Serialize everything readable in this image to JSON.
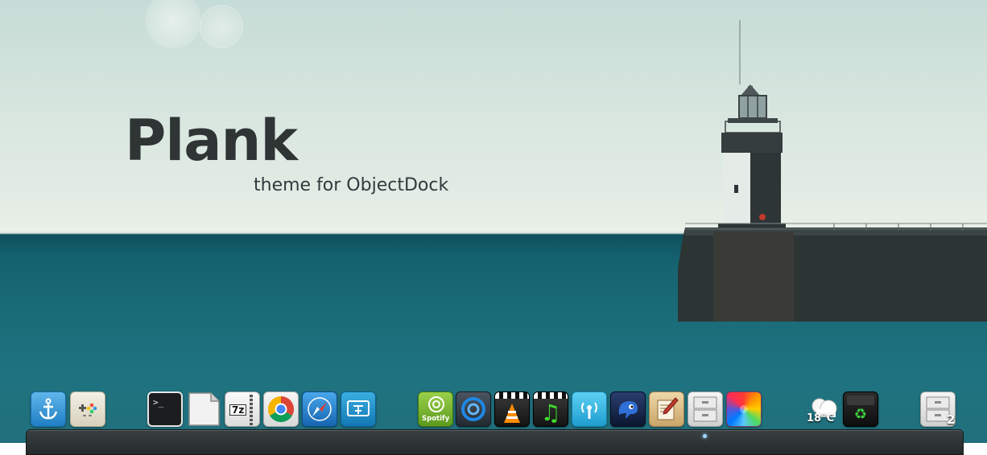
{
  "headline": {
    "title": "Plank",
    "subtitle": "theme for ObjectDock"
  },
  "dock": {
    "items": [
      {
        "name": "plank-anchor",
        "icon": "anchor-icon"
      },
      {
        "name": "game-controller",
        "icon": "gamepad-icon"
      },
      {
        "name": "terminal",
        "icon": "terminal-icon",
        "label": ">_"
      },
      {
        "name": "text-document",
        "icon": "document-icon"
      },
      {
        "name": "7zip-archive",
        "icon": "archive-icon",
        "label": "7z"
      },
      {
        "name": "chrome-browser",
        "icon": "chrome-icon"
      },
      {
        "name": "safari-browser",
        "icon": "compass-icon"
      },
      {
        "name": "screenshot-tool",
        "icon": "screenshot-icon"
      },
      {
        "name": "spotify",
        "icon": "spotify-icon",
        "label": "Spotify"
      },
      {
        "name": "media-player",
        "icon": "swirl-player-icon"
      },
      {
        "name": "vlc-player",
        "icon": "traffic-cone-icon"
      },
      {
        "name": "music-player",
        "icon": "music-note-icon"
      },
      {
        "name": "wireless-network",
        "icon": "wireless-icon"
      },
      {
        "name": "pidgin-chat",
        "icon": "bird-icon"
      },
      {
        "name": "text-editor",
        "icon": "pen-paper-icon"
      },
      {
        "name": "file-cabinet",
        "icon": "file-cabinet-icon"
      },
      {
        "name": "color-picker",
        "icon": "color-wheel-icon"
      },
      {
        "name": "weather-widget",
        "icon": "cloud-weather-icon"
      },
      {
        "name": "recycle-bin",
        "icon": "recycle-icon"
      },
      {
        "name": "file-cabinet-stack",
        "icon": "file-cabinet-icon"
      }
    ],
    "weather": {
      "temperature": "18°C"
    },
    "stack": {
      "count": "2"
    }
  },
  "colors": {
    "sky": "#dbe7e0",
    "sea": "#1a6b78",
    "title": "#2f3435",
    "dock": "#2b3032",
    "running_indicator": "#9fd6ff"
  }
}
